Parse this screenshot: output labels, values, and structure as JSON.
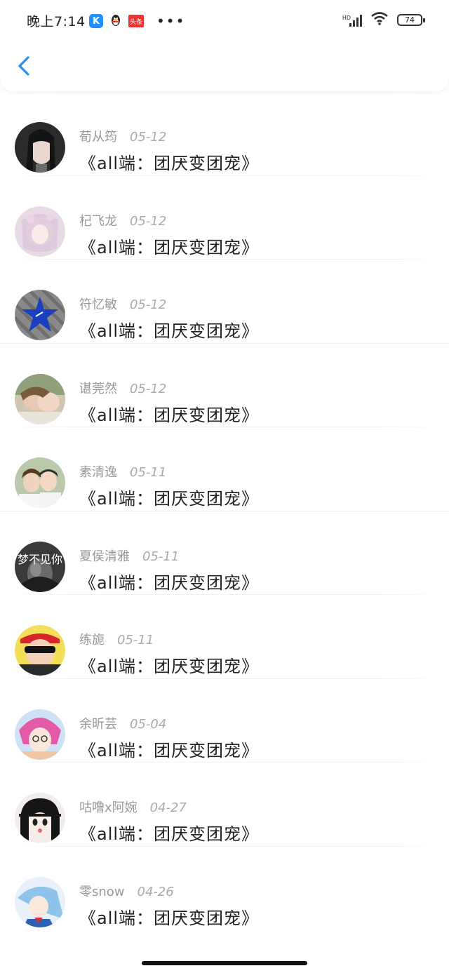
{
  "status_bar": {
    "time": "晚上7:14",
    "app_k": "K",
    "app_tt": "头条",
    "more": "•••",
    "hd_label": "HD",
    "battery": "74"
  },
  "list": {
    "items": [
      {
        "author": "荀从筠",
        "date": "05-12",
        "title": "《all端：团厌变团宠》"
      },
      {
        "author": "杞飞龙",
        "date": "05-12",
        "title": "《all端：团厌变团宠》"
      },
      {
        "author": "符忆敏",
        "date": "05-12",
        "title": "《all端：团厌变团宠》"
      },
      {
        "author": "谌莞然",
        "date": "05-12",
        "title": "《all端：团厌变团宠》"
      },
      {
        "author": "素清逸",
        "date": "05-11",
        "title": "《all端：团厌变团宠》"
      },
      {
        "author": "夏侯清雅",
        "date": "05-11",
        "title": "《all端：团厌变团宠》"
      },
      {
        "author": "练旎",
        "date": "05-11",
        "title": "《all端：团厌变团宠》"
      },
      {
        "author": "余昕芸",
        "date": "05-04",
        "title": "《all端：团厌变团宠》"
      },
      {
        "author": "咕噜x阿婉",
        "date": "04-27",
        "title": "《all端：团厌变团宠》"
      },
      {
        "author": "零snow",
        "date": "04-26",
        "title": "《all端：团厌变团宠》"
      }
    ],
    "avatar_2_text": "梦不见你"
  },
  "colors": {
    "accent": "#2a8ff0",
    "separator": "#f0f0f0"
  }
}
